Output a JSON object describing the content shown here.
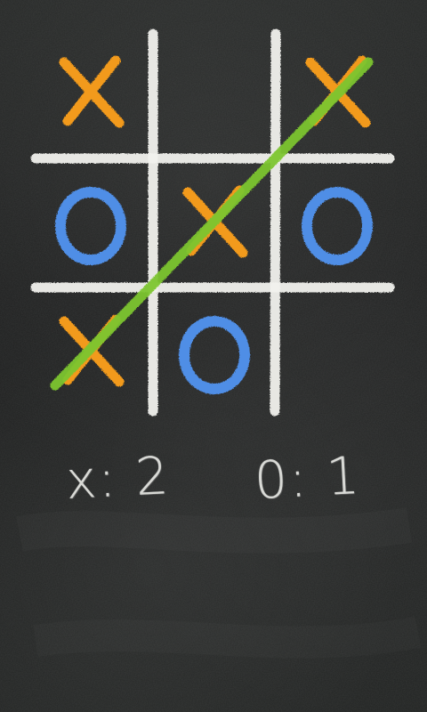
{
  "game": {
    "board": [
      [
        "X",
        "",
        "X"
      ],
      [
        "O",
        "X",
        "O"
      ],
      [
        "X",
        "O",
        ""
      ]
    ],
    "winning_line": "anti-diagonal",
    "colors": {
      "chalkboard": "#1e1f1f",
      "grid": "#f2f2ee",
      "x_mark": "#f29a1a",
      "o_mark": "#4f8ee6",
      "win_line": "#7dc62f",
      "score_text": "#d9dad6"
    }
  },
  "score": {
    "x_label": "x: 2",
    "o_label": "0: 1"
  }
}
